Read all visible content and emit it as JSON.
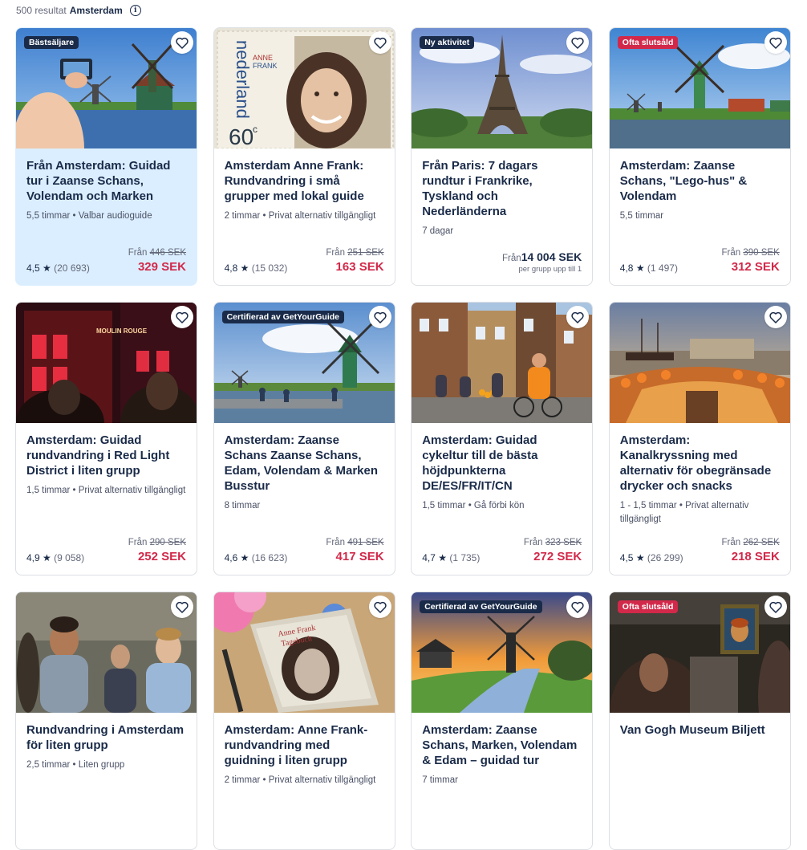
{
  "results": {
    "count_text": "500 resultat",
    "place": "Amsterdam",
    "info_icon": "i"
  },
  "cards": [
    {
      "title": "Från Amsterdam: Guidad tur i Zaanse Schans, Volendam och Marken",
      "meta": "5,5 timmar • Valbar audioguide",
      "badge": "Bästsäljare",
      "from_label": "Från",
      "old_price": "446 SEK",
      "rating": "4,5",
      "star": "★",
      "reviews": "(20 693)",
      "price": "329 SEK"
    },
    {
      "title": "Amsterdam Anne Frank: Rundvandring i små grupper med lokal guide",
      "meta": "2 timmar • Privat alternativ tillgängligt",
      "badge": "",
      "from_label": "Från",
      "old_price": "251 SEK",
      "rating": "4,8",
      "star": "★",
      "reviews": "(15 032)",
      "price": "163 SEK"
    },
    {
      "title": "Från Paris: 7 dagars rundtur i Frankrike, Tyskland och Nederländerna",
      "meta": "7 dagar",
      "badge": "Ny aktivitet",
      "from_label": "Från",
      "price": "14 004 SEK",
      "per": "per grupp upp till 1"
    },
    {
      "title": "Amsterdam: Zaanse Schans, \"Lego-hus\" & Volendam",
      "meta": "5,5 timmar",
      "badge": "Ofta slutsåld",
      "from_label": "Från",
      "old_price": "390 SEK",
      "rating": "4,8",
      "star": "★",
      "reviews": "(1 497)",
      "price": "312 SEK"
    },
    {
      "title": "Amsterdam: Guidad rundvandring i Red Light District i liten grupp",
      "meta": "1,5 timmar • Privat alternativ tillgängligt",
      "badge": "",
      "from_label": "Från",
      "old_price": "290 SEK",
      "rating": "4,9",
      "star": "★",
      "reviews": "(9 058)",
      "price": "252 SEK"
    },
    {
      "title": "Amsterdam: Zaanse Schans Zaanse Schans, Edam, Volendam & Marken Busstur",
      "meta": "8 timmar",
      "badge": "Certifierad av GetYourGuide",
      "from_label": "Från",
      "old_price": "491 SEK",
      "rating": "4,6",
      "star": "★",
      "reviews": "(16 623)",
      "price": "417 SEK"
    },
    {
      "title": "Amsterdam: Guidad cykeltur till de bästa höjdpunkterna DE/ES/FR/IT/CN",
      "meta": "1,5 timmar • Gå förbi kön",
      "badge": "",
      "from_label": "Från",
      "old_price": "323 SEK",
      "rating": "4,7",
      "star": "★",
      "reviews": "(1 735)",
      "price": "272 SEK"
    },
    {
      "title": "Amsterdam: Kanalkryssning med alternativ för obegränsade drycker och snacks",
      "meta": "1 - 1,5 timmar • Privat alternativ tillgängligt",
      "badge": "",
      "from_label": "Från",
      "old_price": "262 SEK",
      "rating": "4,5",
      "star": "★",
      "reviews": "(26 299)",
      "price": "218 SEK"
    },
    {
      "title": "Rundvandring i Amsterdam för liten grupp",
      "meta": "2,5 timmar • Liten grupp",
      "badge": ""
    },
    {
      "title": "Amsterdam: Anne Frank-rundvandring med guidning i liten grupp",
      "meta": "2 timmar • Privat alternativ tillgängligt",
      "badge": ""
    },
    {
      "title": "Amsterdam: Zaanse Schans, Marken, Volendam & Edam – guidad tur",
      "meta": "7 timmar",
      "badge": "Certifierad av GetYourGuide"
    },
    {
      "title": "Van Gogh Museum Biljett",
      "meta": "",
      "badge": "Ofta slutsåld"
    }
  ],
  "stamp": {
    "country": "nederland",
    "name_line1": "ANNE",
    "name_line2": "FRANK",
    "value": "60",
    "unit": "c"
  },
  "book": {
    "line1": "Anne Frank",
    "line2": "Tagebuch"
  },
  "sign": {
    "text": "MOULIN ROUGE"
  },
  "colors": {
    "accent": "#d2294a",
    "navy": "#1a2b49",
    "highlight": "#dbeeff"
  }
}
